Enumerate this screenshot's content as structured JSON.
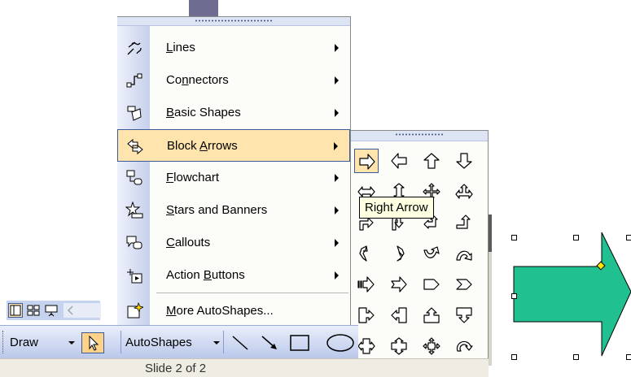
{
  "main_menu": {
    "items": [
      {
        "label": "Lines",
        "icon": "lines-icon",
        "has_submenu": true
      },
      {
        "label": "Connectors",
        "icon": "connectors-icon",
        "has_submenu": true
      },
      {
        "label": "Basic Shapes",
        "icon": "basic-shapes-icon",
        "has_submenu": true
      },
      {
        "label": "Block Arrows",
        "icon": "block-arrows-icon",
        "has_submenu": true,
        "active": true
      },
      {
        "label": "Flowchart",
        "icon": "flowchart-icon",
        "has_submenu": true
      },
      {
        "label": "Stars and Banners",
        "icon": "stars-banners-icon",
        "has_submenu": true
      },
      {
        "label": "Callouts",
        "icon": "callouts-icon",
        "has_submenu": true
      },
      {
        "label": "Action Buttons",
        "icon": "action-buttons-icon",
        "has_submenu": true
      },
      {
        "label": "More AutoShapes...",
        "icon": "more-autoshapes-icon",
        "has_submenu": false
      }
    ]
  },
  "block_arrows_menu": {
    "tooltip": "Right Arrow",
    "selected": "right-arrow",
    "grid_icons": [
      "right-arrow-icon",
      "left-arrow-icon",
      "up-arrow-icon",
      "down-arrow-icon",
      "left-right-arrow-icon",
      "up-down-arrow-icon",
      "quad-arrow-icon",
      "left-right-up-arrow-icon",
      "bent-arrow-icon",
      "u-turn-arrow-icon",
      "left-up-arrow-icon",
      "bent-up-arrow-icon",
      "curved-right-arrow-icon",
      "curved-left-arrow-icon",
      "curved-up-arrow-icon",
      "curved-down-arrow-icon",
      "striped-right-arrow-icon",
      "notched-right-arrow-icon",
      "pentagon-icon",
      "chevron-icon",
      "right-arrow-callout-icon",
      "left-arrow-callout-icon",
      "up-arrow-callout-icon",
      "down-arrow-callout-icon",
      "left-right-arrow-callout-icon",
      "up-down-arrow-callout-icon",
      "quad-arrow-callout-icon",
      "circular-arrow-icon"
    ]
  },
  "drawing_toolbar": {
    "draw_label": "Draw",
    "autoshapes_label": "AutoShapes",
    "tools": [
      "select-pointer-icon",
      "line-icon",
      "arrow-icon",
      "rectangle-icon",
      "oval-icon"
    ]
  },
  "view_buttons": [
    "normal-view-icon",
    "slide-sorter-view-icon",
    "slide-show-icon"
  ],
  "status": {
    "slide_text": "Slide 2 of 2"
  },
  "colors": {
    "menu_highlight": "#ffe4ad",
    "highlight_border": "#3a5a9c",
    "arrow_fill": "#20c090",
    "toolbar_blue": "#c6d3ef"
  }
}
